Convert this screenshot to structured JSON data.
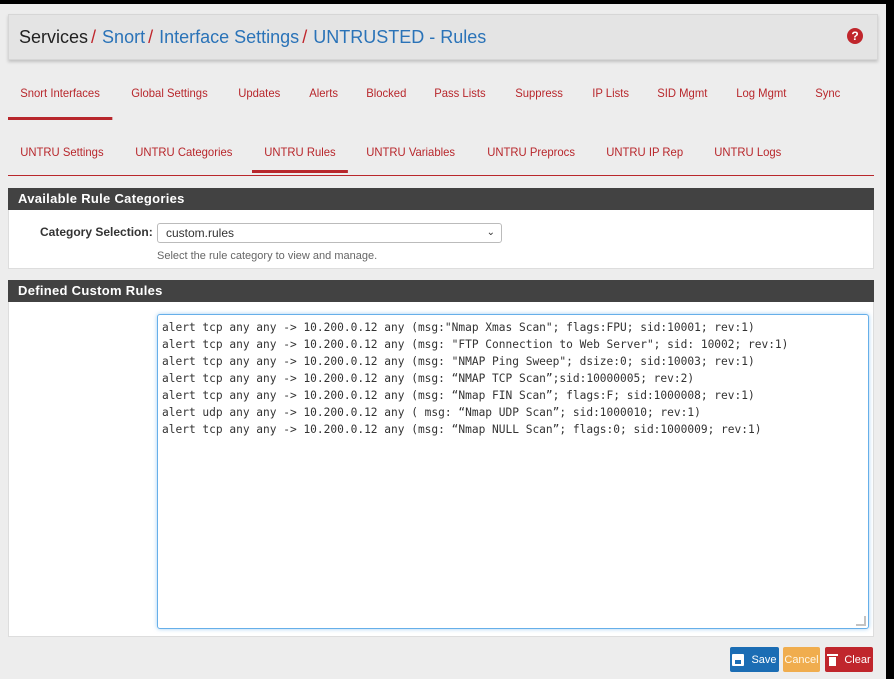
{
  "breadcrumb": {
    "items": [
      {
        "label": "Services",
        "link": false
      },
      {
        "label": "Snort",
        "link": true
      },
      {
        "label": "Interface Settings",
        "link": true
      },
      {
        "label": "UNTRUSTED - Rules",
        "link": true
      }
    ],
    "separator": "/",
    "help_icon": "?"
  },
  "tabs_main": [
    {
      "label": "Snort Interfaces",
      "active": true
    },
    {
      "label": "Global Settings",
      "active": false
    },
    {
      "label": "Updates",
      "active": false
    },
    {
      "label": "Alerts",
      "active": false
    },
    {
      "label": "Blocked",
      "active": false
    },
    {
      "label": "Pass Lists",
      "active": false
    },
    {
      "label": "Suppress",
      "active": false
    },
    {
      "label": "IP Lists",
      "active": false
    },
    {
      "label": "SID Mgmt",
      "active": false
    },
    {
      "label": "Log Mgmt",
      "active": false
    },
    {
      "label": "Sync",
      "active": false
    }
  ],
  "tabs_interface": [
    {
      "label": "UNTRU Settings",
      "active": false
    },
    {
      "label": "UNTRU Categories",
      "active": false
    },
    {
      "label": "UNTRU Rules",
      "active": true
    },
    {
      "label": "UNTRU Variables",
      "active": false
    },
    {
      "label": "UNTRU Preprocs",
      "active": false
    },
    {
      "label": "UNTRU IP Rep",
      "active": false
    },
    {
      "label": "UNTRU Logs",
      "active": false
    }
  ],
  "categories_panel": {
    "title": "Available Rule Categories",
    "label": "Category Selection:",
    "selected": "custom.rules",
    "help": "Select the rule category to view and manage."
  },
  "custom_rules_panel": {
    "title": "Defined Custom Rules",
    "lines": [
      "alert tcp any any -> 10.200.0.12 any (msg:\"Nmap Xmas Scan\"; flags:FPU; sid:10001; rev:1)",
      "alert tcp any any -> 10.200.0.12 any (msg: \"FTP Connection to Web Server\"; sid: 10002; rev:1)",
      "alert tcp any any -> 10.200.0.12 any (msg: \"NMAP Ping Sweep\"; dsize:0; sid:10003; rev:1)",
      "alert tcp any any -> 10.200.0.12 any (msg: “NMAP TCP Scan”;sid:10000005; rev:2)",
      "alert tcp any any -> 10.200.0.12 any (msg: “Nmap FIN Scan”; flags:F; sid:1000008; rev:1)",
      "alert udp any any -> 10.200.0.12 any ( msg: “Nmap UDP Scan”; sid:1000010; rev:1)",
      "alert tcp any any -> 10.200.0.12 any (msg: “Nmap NULL Scan”; flags:0; sid:1000009; rev:1)"
    ]
  },
  "buttons": {
    "save": "Save",
    "cancel": "Cancel",
    "clear": "Clear"
  },
  "colors": {
    "accent": "#b8272c",
    "link": "#2a73b8",
    "panel_header": "#424242",
    "save": "#1b6db4",
    "cancel": "#f0ad4e",
    "clear": "#c0262c"
  }
}
